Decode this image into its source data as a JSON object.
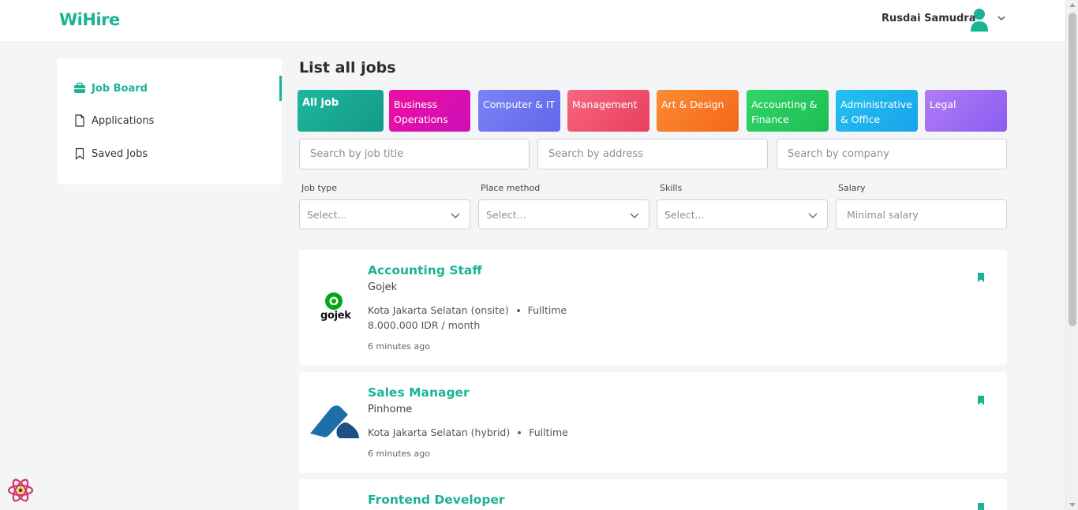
{
  "header": {
    "logo": "WiHire",
    "user_name": "Rusdai Samudra"
  },
  "sidebar": {
    "items": [
      {
        "label": "Job Board",
        "icon": "briefcase-icon",
        "active": true
      },
      {
        "label": "Applications",
        "icon": "document-icon",
        "active": false
      },
      {
        "label": "Saved Jobs",
        "icon": "bookmark-icon",
        "active": false
      }
    ]
  },
  "main": {
    "title": "List all jobs",
    "categories": [
      {
        "label": "All job",
        "from": "#1fb89a",
        "to": "#12998a"
      },
      {
        "label": "Business Operations",
        "from": "#ee0fa0",
        "to": "#cc0fb8"
      },
      {
        "label": "Computer & IT",
        "from": "#7a84f8",
        "to": "#6366e8"
      },
      {
        "label": "Management",
        "from": "#f7667f",
        "to": "#e83f5f"
      },
      {
        "label": "Art & Design",
        "from": "#fb8b35",
        "to": "#f4671b"
      },
      {
        "label": "Accounting & Finance",
        "from": "#33d46a",
        "to": "#1cbe55"
      },
      {
        "label": "Administrative & Office",
        "from": "#23c0f0",
        "to": "#1aa4ea"
      },
      {
        "label": "Legal",
        "from": "#b17cf6",
        "to": "#8b5cf0"
      }
    ],
    "search": {
      "title_placeholder": "Search by job title",
      "address_placeholder": "Search by address",
      "company_placeholder": "Search by company"
    },
    "filters": {
      "job_type_label": "Job type",
      "job_type_placeholder": "Select...",
      "place_label": "Place method",
      "place_placeholder": "Select...",
      "skills_label": "Skills",
      "skills_placeholder": "Select...",
      "salary_label": "Salary",
      "salary_placeholder": "Minimal salary"
    },
    "jobs": [
      {
        "title": "Accounting Staff",
        "company": "Gojek",
        "location": "Kota Jakarta Selatan (onsite)",
        "type": "Fulltime",
        "salary": "8.000.000 IDR / month",
        "posted": "6 minutes ago",
        "logo_text": "gojek"
      },
      {
        "title": "Sales Manager",
        "company": "Pinhome",
        "location": "Kota Jakarta Selatan (hybrid)",
        "type": "Fulltime",
        "posted": "6 minutes ago"
      },
      {
        "title": "Frontend Developer"
      }
    ]
  },
  "colors": {
    "accent": "#1ab394",
    "background": "#f4f5f7"
  }
}
